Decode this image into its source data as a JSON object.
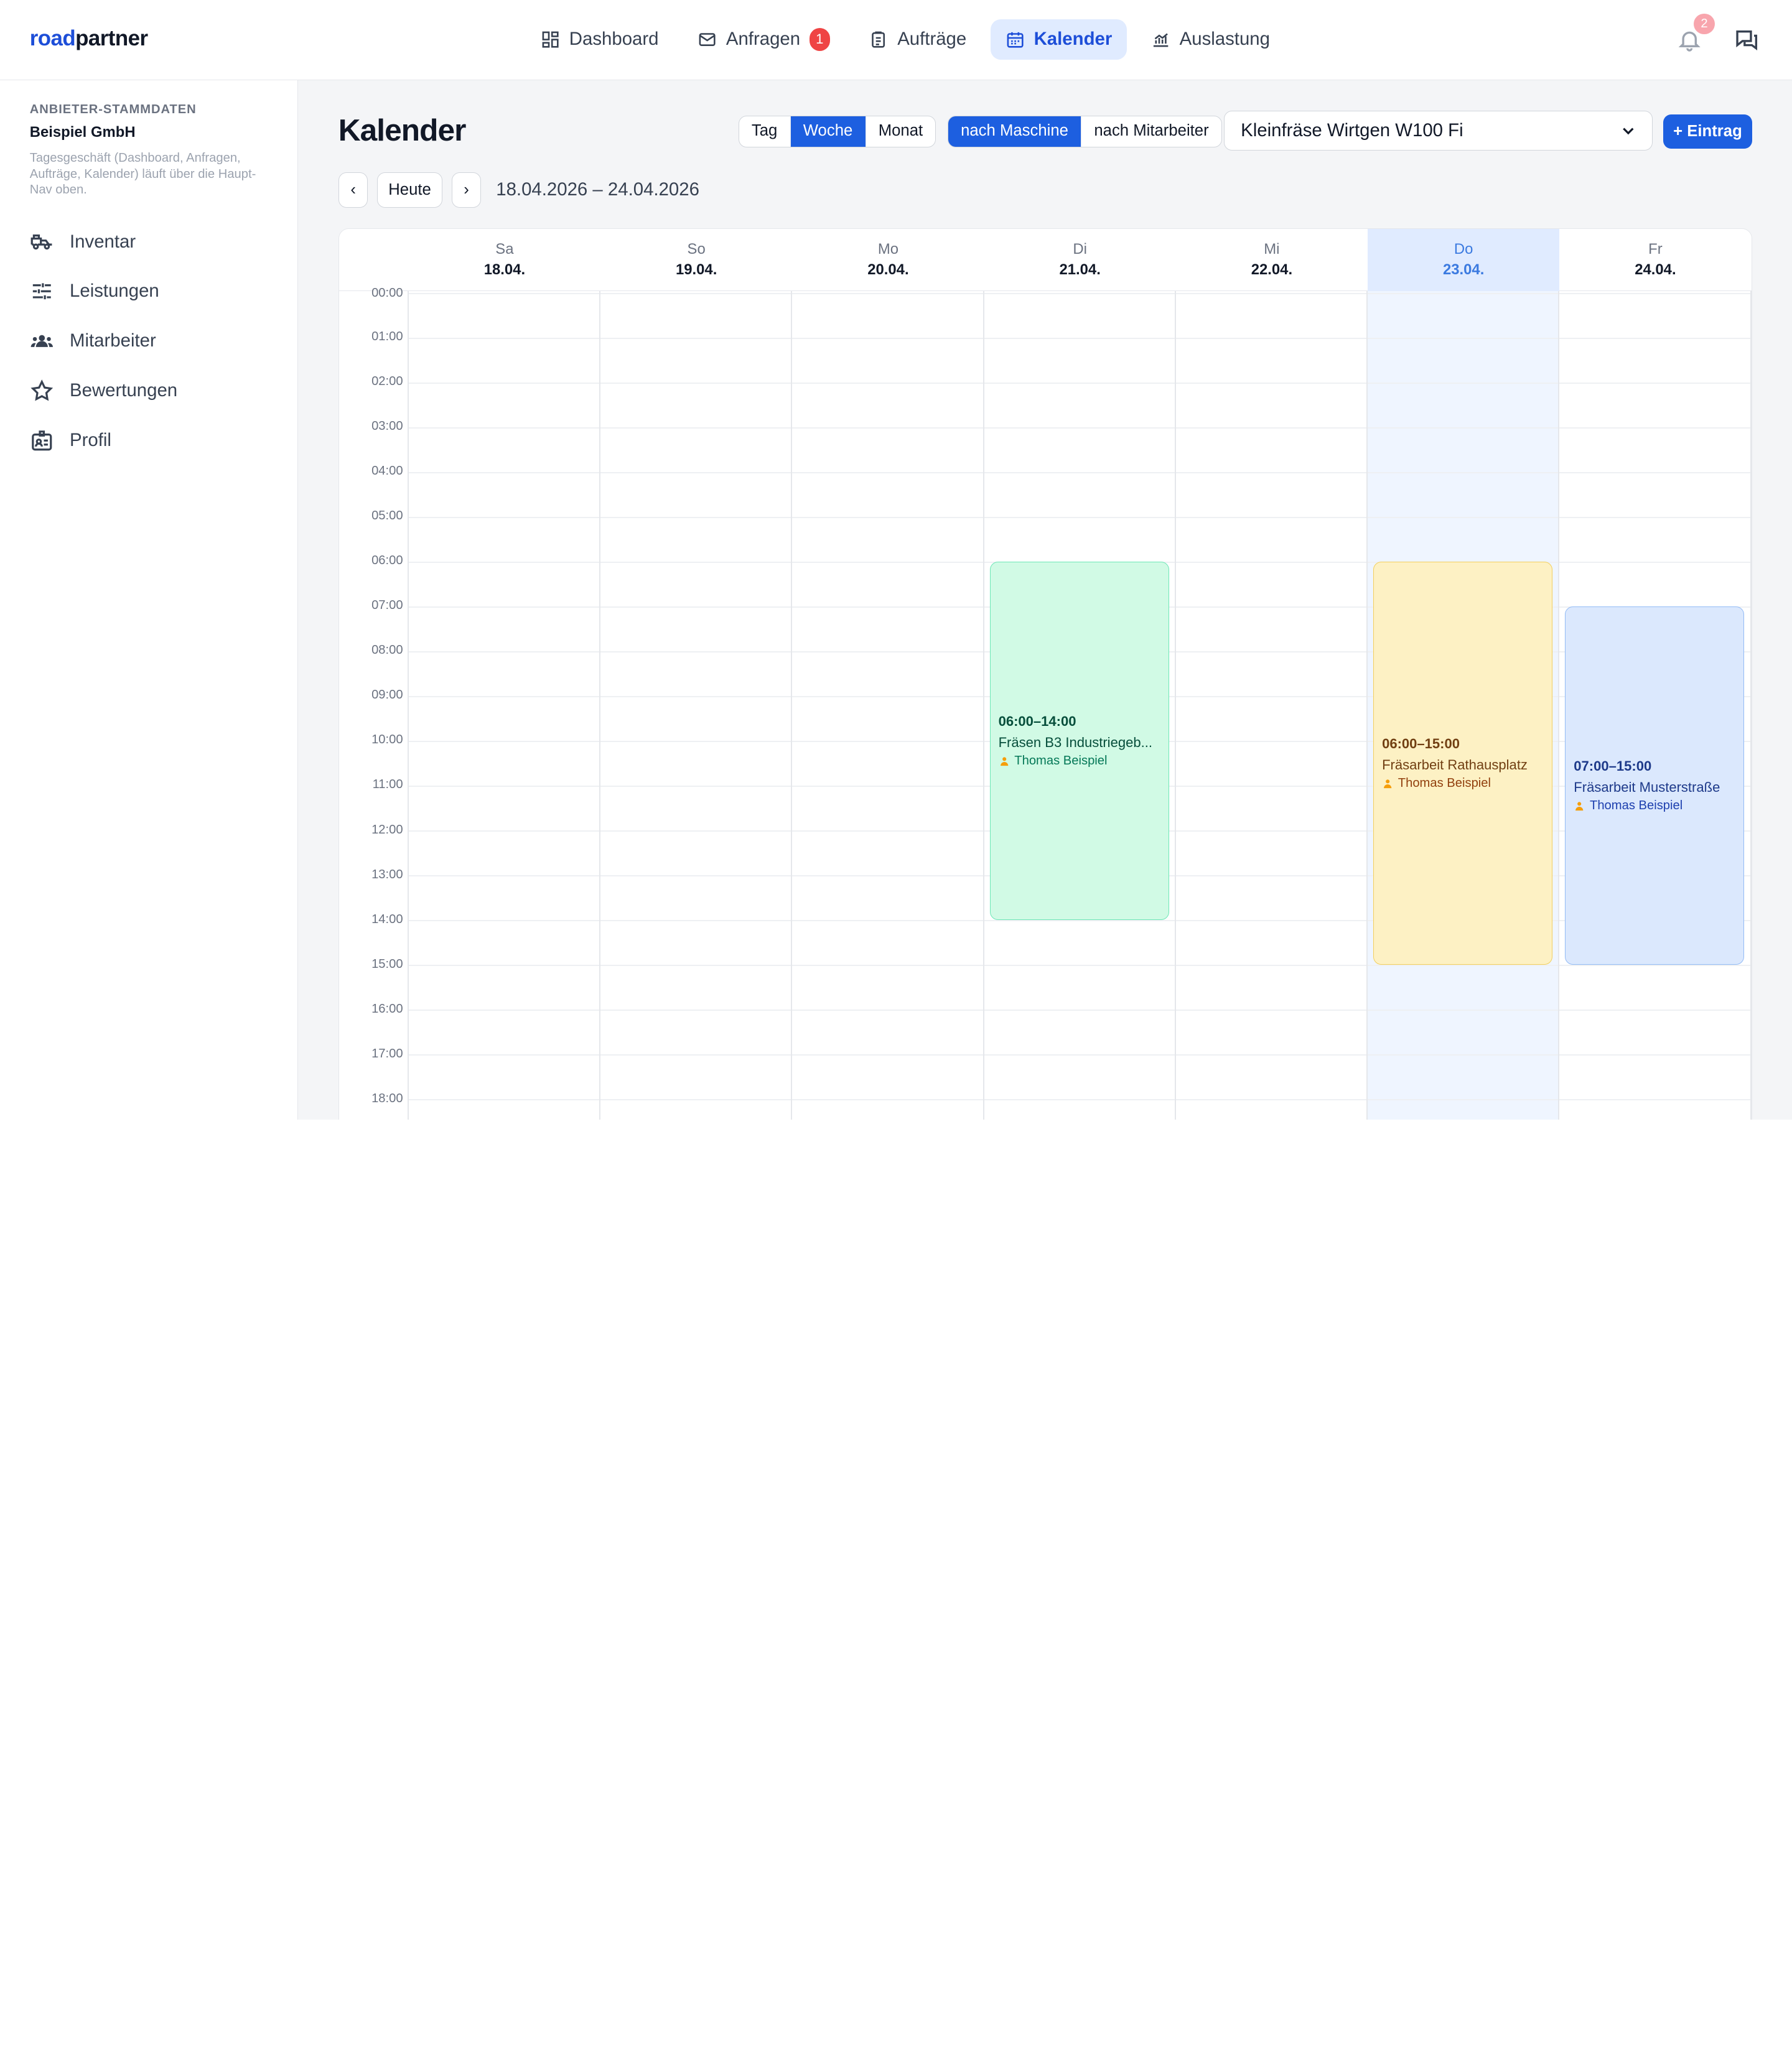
{
  "brand": {
    "part1": "road",
    "part2": "partner",
    "color": "#1d4ed8"
  },
  "nav": {
    "items": [
      {
        "label": "Dashboard",
        "icon": "dashboard-icon"
      },
      {
        "label": "Anfragen",
        "icon": "mail-icon",
        "badge": "1"
      },
      {
        "label": "Aufträge",
        "icon": "clipboard-icon"
      },
      {
        "label": "Kalender",
        "icon": "calendar-icon",
        "active": true
      },
      {
        "label": "Auslastung",
        "icon": "chart-icon"
      }
    ],
    "notifications_count": "2"
  },
  "sidebar": {
    "kicker": "ANBIETER-STAMMDATEN",
    "company": "Beispiel GmbH",
    "note": "Tagesgeschäft (Dashboard, Anfragen, Aufträge, Kalender) läuft über die Haupt-Nav oben.",
    "items": [
      {
        "label": "Inventar",
        "icon": "truck-icon"
      },
      {
        "label": "Leistungen",
        "icon": "sliders-icon"
      },
      {
        "label": "Mitarbeiter",
        "icon": "users-icon"
      },
      {
        "label": "Bewertungen",
        "icon": "star-icon"
      },
      {
        "label": "Profil",
        "icon": "id-card-icon"
      }
    ]
  },
  "page": {
    "title": "Kalender",
    "view_options": [
      "Tag",
      "Woche",
      "Monat"
    ],
    "view_selected": "Woche",
    "group_options": [
      "nach Maschine",
      "nach Mitarbeiter"
    ],
    "group_selected": "nach Maschine",
    "machine": "Kleinfräse Wirtgen W100 Fi",
    "add_label": "+ Eintrag",
    "prev": "‹",
    "today": "Heute",
    "next": "›",
    "range": "18.04.2026 – 24.04.2026"
  },
  "calendar": {
    "days": [
      {
        "name": "Sa",
        "date": "18.04."
      },
      {
        "name": "So",
        "date": "19.04."
      },
      {
        "name": "Mo",
        "date": "20.04."
      },
      {
        "name": "Di",
        "date": "21.04."
      },
      {
        "name": "Mi",
        "date": "22.04."
      },
      {
        "name": "Do",
        "date": "23.04.",
        "today": true
      },
      {
        "name": "Fr",
        "date": "24.04."
      }
    ],
    "hours": [
      "00:00",
      "01:00",
      "02:00",
      "03:00",
      "04:00",
      "05:00",
      "06:00",
      "07:00",
      "08:00",
      "09:00",
      "10:00",
      "11:00",
      "12:00",
      "13:00",
      "14:00",
      "15:00",
      "16:00",
      "17:00",
      "18:00"
    ],
    "events": [
      {
        "day": 3,
        "start": 6,
        "end": 14,
        "time": "06:00–14:00",
        "title": "Fräsen B3 Industriegeb...",
        "person": "Thomas Beispiel",
        "color": "green"
      },
      {
        "day": 5,
        "start": 6,
        "end": 15,
        "time": "06:00–15:00",
        "title": "Fräsarbeit Rathausplatz",
        "person": "Thomas Beispiel",
        "color": "yellow"
      },
      {
        "day": 6,
        "start": 7,
        "end": 15,
        "time": "07:00–15:00",
        "title": "Fräsarbeit Musterstraße",
        "person": "Thomas Beispiel",
        "color": "blue"
      }
    ]
  }
}
